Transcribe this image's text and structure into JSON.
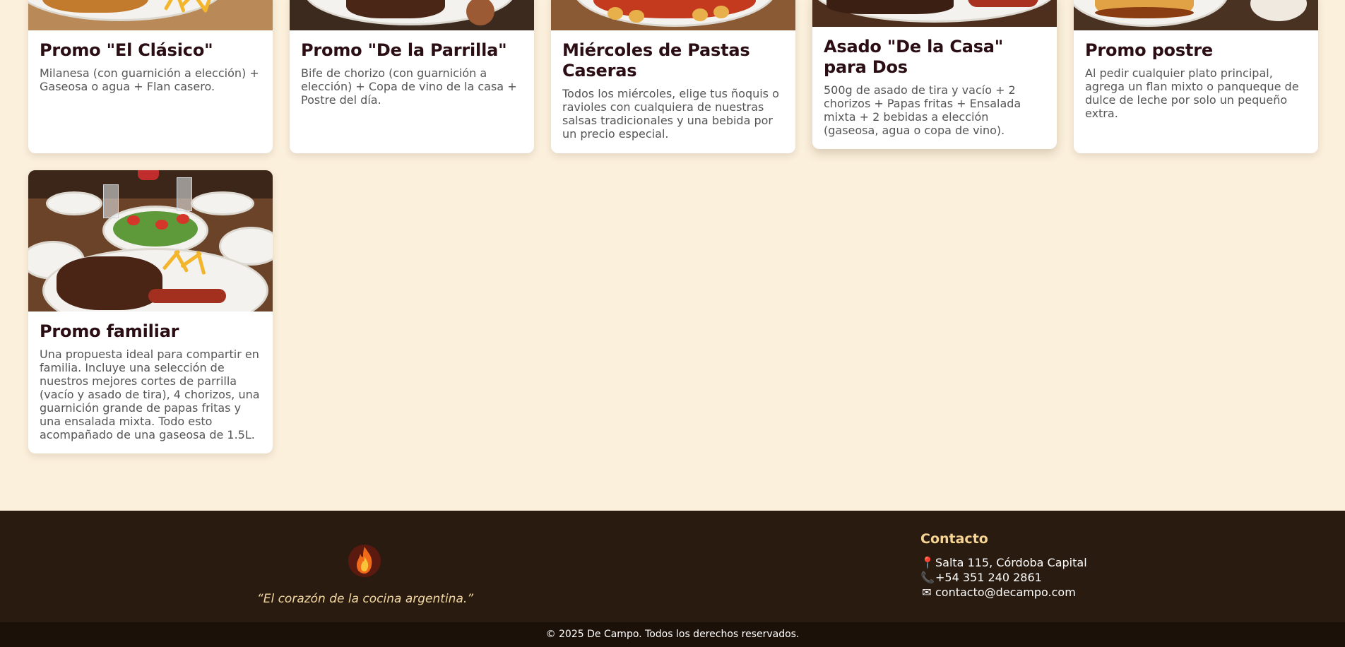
{
  "promos": [
    {
      "title": "Promo \"El Clásico\"",
      "description": "Milanesa (con guarnición a elección) + Gaseosa o agua + Flan casero."
    },
    {
      "title": "Promo \"De la Parrilla\"",
      "description": "Bife de chorizo (con guarnición a elección) + Copa de vino de la casa + Postre del día."
    },
    {
      "title": "Miércoles de Pastas Caseras",
      "description": "Todos los miércoles, elige tus ñoquis o ravioles con cualquiera de nuestras salsas tradicionales y una bebida por un precio especial."
    },
    {
      "title": "Asado \"De la Casa\" para Dos",
      "description": "500g de asado de tira y vacío + 2 chorizos + Papas fritas + Ensalada mixta + 2 bebidas a elección (gaseosa, agua o copa de vino)."
    },
    {
      "title": "Promo postre",
      "description": "Al pedir cualquier plato principal, agrega un flan mixto o panqueque de dulce de leche por solo un pequeño extra."
    },
    {
      "title": "Promo familiar",
      "description": "Una propuesta ideal para compartir en familia. Incluye una selección de nuestros mejores cortes de parrilla (vacío y asado de tira), 4 chorizos, una guarnición grande de papas fritas y una ensalada mixta. Todo esto acompañado de una gaseosa de 1.5L."
    }
  ],
  "footer": {
    "logo_icon": "flame-icon",
    "slogan": "“El corazón de la cocina argentina.”",
    "contact_title": "Contacto",
    "address": "Salta 115, Córdoba Capital",
    "phone": "+54 351 240 2861",
    "email": "contacto@decampo.com",
    "copyright": "© 2025 De Campo. Todos los derechos reservados."
  },
  "colors": {
    "page_background": "#fbf0dc",
    "card_title": "#2b0d14",
    "footer_background": "#2a1b10",
    "footer_accent": "#f6d493"
  }
}
